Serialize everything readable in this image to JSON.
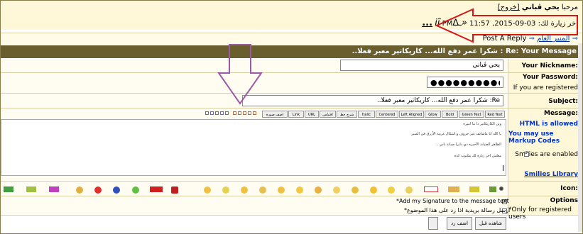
{
  "header": {
    "welcome_prefix": "مرحبا",
    "username": "يحي ڤباني",
    "logout_label": "[خروج]",
    "last_visit_label": "اخر زيارة لك:",
    "last_visit_date": "03-09-2015,",
    "last_visit_time": "11:57",
    "last_visit_suffix": "PM",
    "last_visit_link": "...",
    "decor_text": "«ـ∆ı̇ȋ"
  },
  "nav": {
    "forum_link": "المنبر العام",
    "post_reply": "Post A Reply"
  },
  "title_bar": "Re: Your Message : شكرا عمر دفع الله... كاريكاتير معبر فعلا..",
  "form": {
    "nickname_label": "Your Nickname:",
    "nickname_value": "يحي ڤباني",
    "password_label": "Your Password:",
    "password_value": "●●●●●●●●●●●",
    "registered_note": "If you are registered",
    "subject_label": "Subject:",
    "subject_value": "Re: شكرا عمر دفع الله... كاريكاتير معبر فعلا..",
    "message_label": "Message:",
    "html_allowed": "HTML is allowed",
    "markup_link": "You may use Markup Codes",
    "smilies_enabled": "Smilies are enabled",
    "smilies_library": "Smilies Library",
    "icon_label": "Icon:",
    "options_label": "Options",
    "options_note": "*Only for registered users",
    "add_signature": "*Add my Signature to the message text",
    "email_notify": "ارسل رسالة بريدية اذا رد على هذا الموضوع*"
  },
  "toolbar": {
    "buttons": [
      "Red Text",
      "Green Text",
      "Bold",
      "Glow",
      "Left Aligned",
      "Centered",
      "Italic",
      "شرح خط",
      "اقتباس",
      "URL",
      "Link",
      "اضف صورة"
    ]
  },
  "message_lines": [
    "وين الكاريكاتير دا ما اميرة",
    "يا الله انا ماشايف غير حروف و اشكال غريبة الأزرق في المنبر",
    "الظاهر الصيانة الأخيرة دي دايرا صيانة تاني ..",
    "معلش اخر زيارة لك مكتوب كده"
  ],
  "buttons": {
    "preview": "شاهده قبل نشره",
    "submit": "اضف رد"
  },
  "colors": {
    "title_bg": "#6a5e2e",
    "label_bg": "#fff8d8",
    "annotation_red": "#d81818",
    "annotation_purple": "#9a5aa8"
  }
}
